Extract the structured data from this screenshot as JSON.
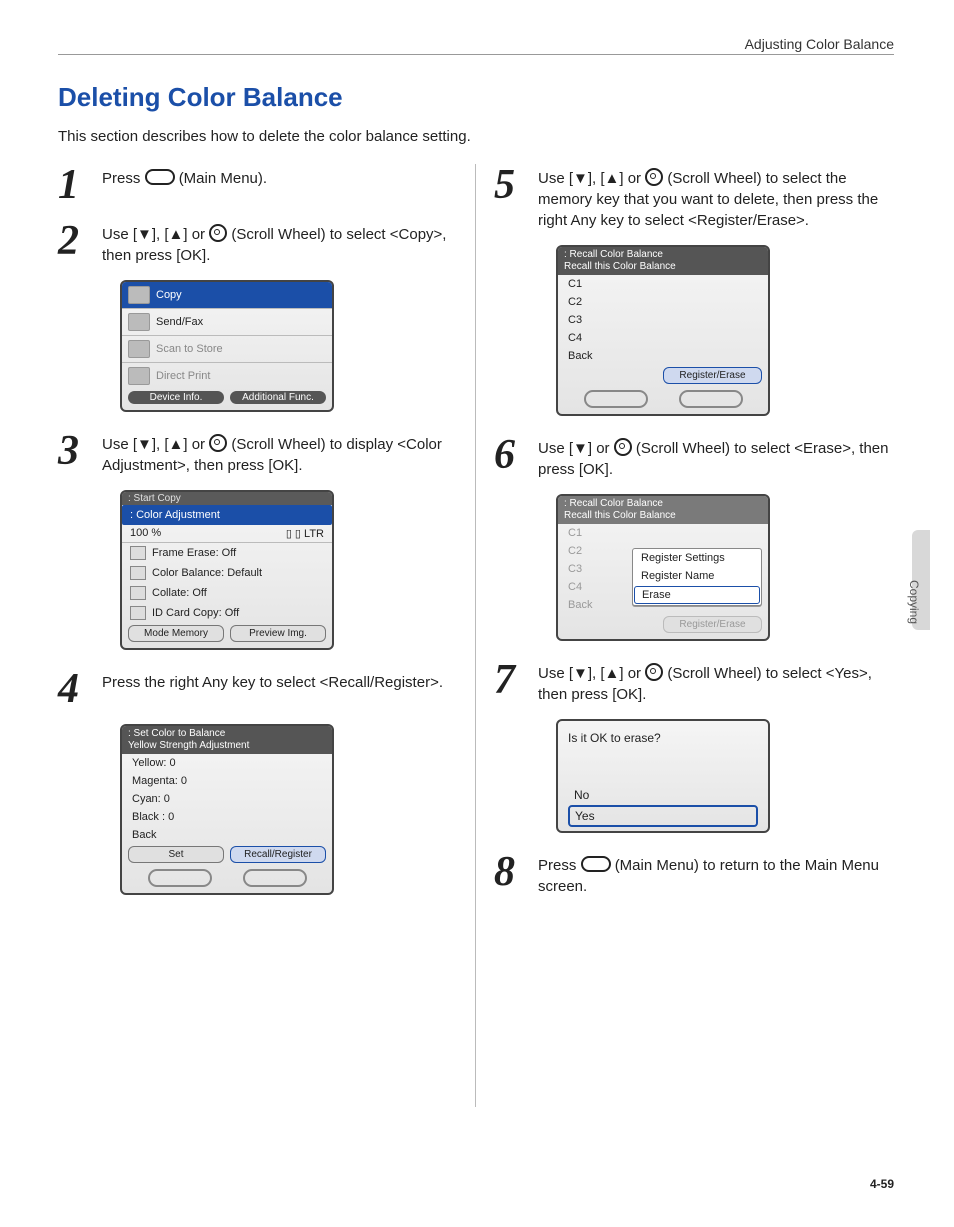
{
  "header": {
    "right": "Adjusting Color Balance"
  },
  "title": "Deleting Color Balance",
  "intro": "This section describes how to delete the color balance setting.",
  "side_tab": "Copying",
  "page_number": "4-59",
  "steps": {
    "s1": {
      "num": "1",
      "text_a": "Press ",
      "text_b": " (Main Menu)."
    },
    "s2": {
      "num": "2",
      "text": "Use [▼], [▲] or ",
      "text2": " (Scroll Wheel) to select <Copy>, then press [OK]."
    },
    "s3": {
      "num": "3",
      "text": "Use [▼], [▲] or ",
      "text2": " (Scroll Wheel) to display <Color Adjustment>, then press [OK]."
    },
    "s4": {
      "num": "4",
      "text": "Press the right Any key to select <Recall/Register>."
    },
    "s5": {
      "num": "5",
      "text": "Use [▼], [▲] or ",
      "text2": " (Scroll Wheel) to select the memory key that you want to delete, then press the right Any key to select <Register/Erase>."
    },
    "s6": {
      "num": "6",
      "text": "Use [▼] or ",
      "text2": " (Scroll Wheel) to select <Erase>, then press [OK]."
    },
    "s7": {
      "num": "7",
      "text": "Use [▼], [▲] or ",
      "text2": " (Scroll Wheel) to select <Yes>, then press [OK]."
    },
    "s8": {
      "num": "8",
      "text_a": "Press ",
      "text_b": " (Main Menu) to return to the Main Menu screen."
    }
  },
  "lcd_menu": {
    "items": [
      "Copy",
      "Send/Fax",
      "Scan to Store",
      "Direct Print"
    ],
    "soft_left": "Device Info.",
    "soft_right": "Additional Func."
  },
  "lcd_copy": {
    "top_dim": ": Start Copy",
    "sub": ": Color Adjustment",
    "zoom": "100 %",
    "paper": "LTR",
    "opts": [
      "Frame Erase: Off",
      "Color Balance: Default",
      "Collate: Off",
      "ID Card Copy: Off"
    ],
    "soft_left": "Mode Memory",
    "soft_right": "Preview Img."
  },
  "lcd_balance": {
    "title": ": Set Color to Balance",
    "subtitle": "Yellow Strength Adjustment",
    "items": [
      "Yellow: 0",
      "Magenta: 0",
      "Cyan: 0",
      "Black : 0",
      "Back"
    ],
    "soft_left": "Set",
    "soft_right": "Recall/Register"
  },
  "lcd_recall": {
    "title": ": Recall Color Balance",
    "subtitle": "Recall this Color Balance",
    "items": [
      "C1",
      "C2",
      "C3",
      "C4",
      "Back"
    ],
    "soft_right": "Register/Erase"
  },
  "lcd_recall_popup": {
    "items": [
      "Register Settings",
      "Register Name",
      "Erase"
    ],
    "soft_right": "Register/Erase"
  },
  "lcd_confirm": {
    "question": "Is it OK to erase?",
    "no": "No",
    "yes": "Yes"
  }
}
